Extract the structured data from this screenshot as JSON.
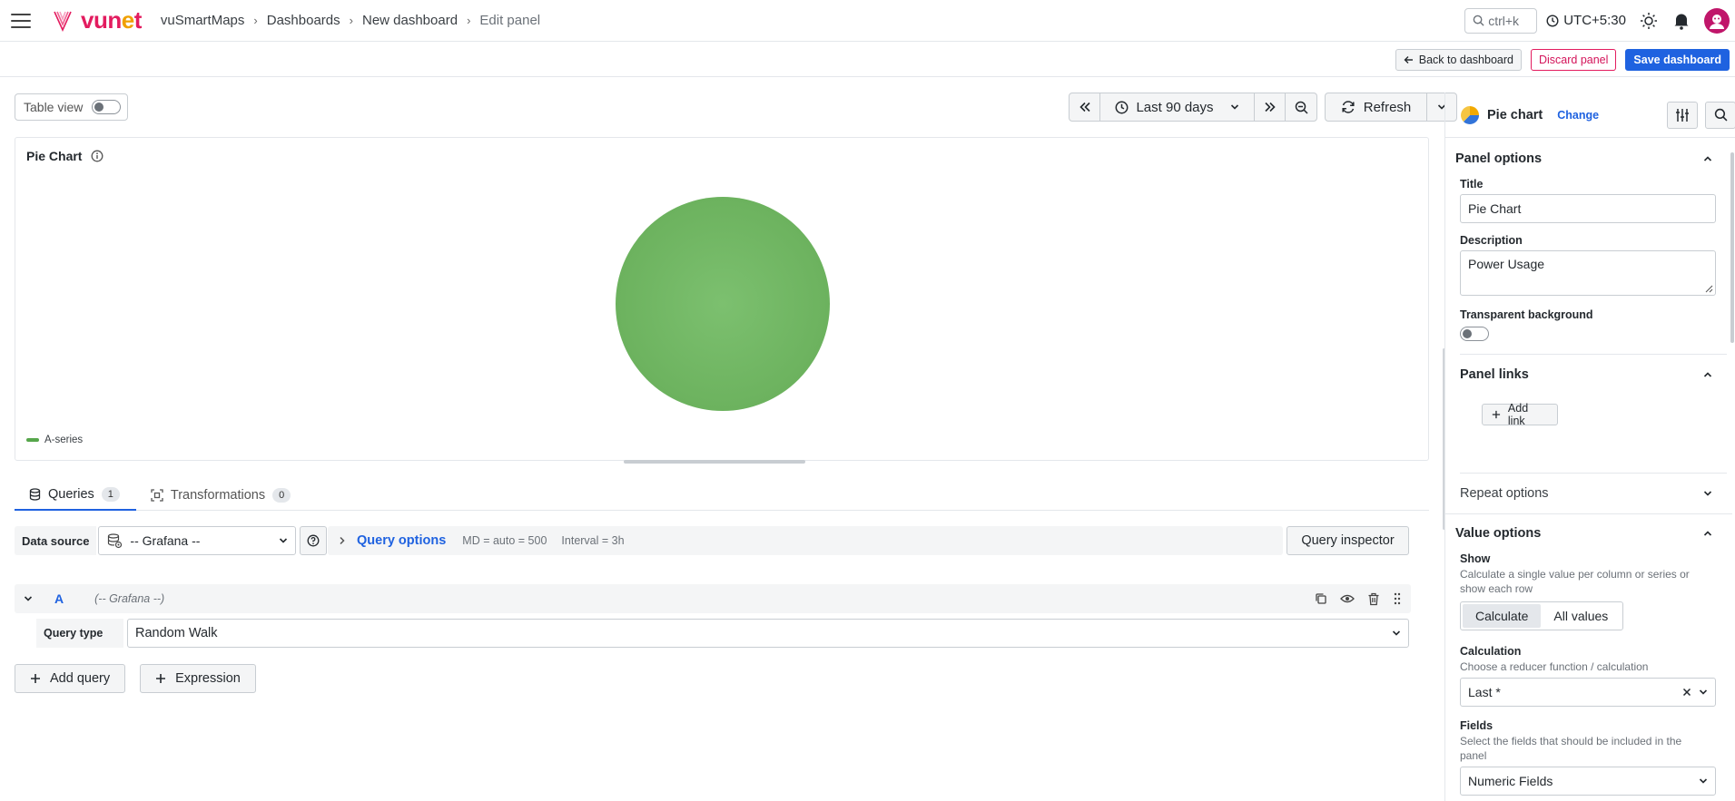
{
  "topbar": {
    "brand": "vunet",
    "breadcrumbs": [
      "vuSmartMaps",
      "Dashboards",
      "New dashboard",
      "Edit panel"
    ],
    "search_hint": "ctrl+k",
    "timezone": "UTC+5:30"
  },
  "actions": {
    "back": "Back to dashboard",
    "discard": "Discard panel",
    "save": "Save dashboard"
  },
  "toolbar": {
    "table_view": "Table view",
    "time_range": "Last 90 days",
    "refresh": "Refresh"
  },
  "preview": {
    "title": "Pie Chart",
    "legend": "A-series"
  },
  "chart_data": {
    "type": "pie",
    "categories": [
      "A-series"
    ],
    "values": [
      100
    ],
    "colors": [
      "#56a64b"
    ],
    "title": "Pie Chart",
    "legend_position": "bottom-left"
  },
  "query_tabs": [
    {
      "label": "Queries",
      "count": "1"
    },
    {
      "label": "Transformations",
      "count": "0"
    }
  ],
  "datasource": {
    "label": "Data source",
    "value": "-- Grafana --",
    "query_options_label": "Query options",
    "md": "MD = auto = 500",
    "interval": "Interval = 3h",
    "inspector": "Query inspector"
  },
  "query": {
    "ref_id": "A",
    "ds_name": "(-- Grafana --)",
    "type_label": "Query type",
    "type_value": "Random Walk"
  },
  "add": {
    "query": "Add query",
    "expression": "Expression"
  },
  "options": {
    "viz_name": "Pie chart",
    "change": "Change",
    "panel_options": {
      "heading": "Panel options",
      "title_label": "Title",
      "title_value": "Pie Chart",
      "desc_label": "Description",
      "desc_value": "Power Usage",
      "transparent_label": "Transparent background"
    },
    "panel_links": {
      "heading": "Panel links",
      "add_link": "Add link"
    },
    "repeat_options": {
      "heading": "Repeat options"
    },
    "value_options": {
      "heading": "Value options",
      "show_label": "Show",
      "show_desc": "Calculate a single value per column or series or show each row",
      "seg_calculate": "Calculate",
      "seg_all": "All values",
      "calc_label": "Calculation",
      "calc_desc": "Choose a reducer function / calculation",
      "calc_value": "Last *",
      "fields_label": "Fields",
      "fields_desc": "Select the fields that should be included in the panel",
      "fields_value": "Numeric Fields"
    }
  },
  "colors": {
    "accent": "#1f62e0",
    "danger": "#d4145a",
    "series": "#56a64b"
  }
}
